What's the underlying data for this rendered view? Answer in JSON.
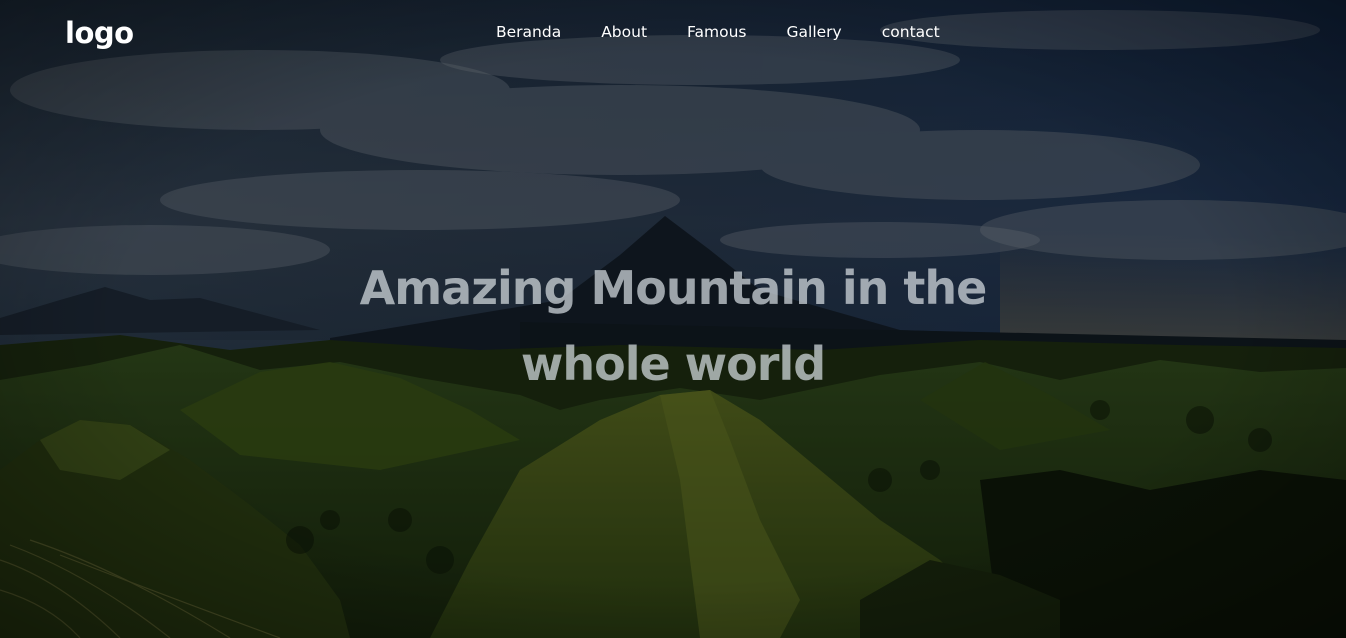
{
  "logo": {
    "text": "logo"
  },
  "nav": {
    "items": [
      {
        "label": "Beranda"
      },
      {
        "label": "About"
      },
      {
        "label": "Famous"
      },
      {
        "label": "Gallery"
      },
      {
        "label": "contact"
      }
    ]
  },
  "hero": {
    "headline_line1": "Amazing Mountain in the",
    "headline_line2": "whole world"
  },
  "colors": {
    "text": "#ffffff",
    "headline": "#d6dce0",
    "overlay": "#000000"
  }
}
